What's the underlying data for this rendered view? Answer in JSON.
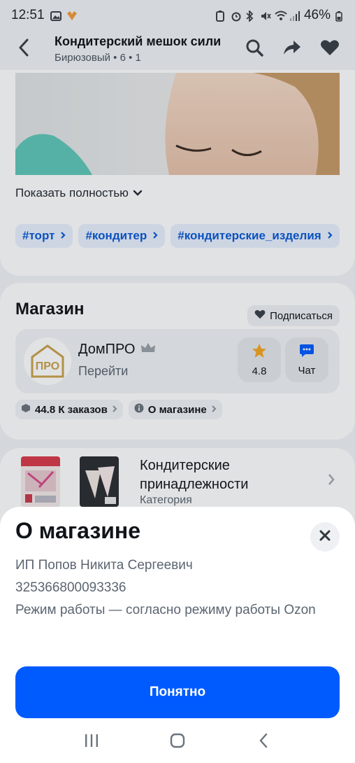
{
  "status_bar": {
    "time": "12:51",
    "battery": "46%"
  },
  "app_bar": {
    "title": "Кондитерский мешок сили",
    "subtitle": "Бирюзовый • 6 • 1"
  },
  "product": {
    "show_more": "Показать полностью",
    "tags": [
      "#торт",
      "#кондитер",
      "#кондитерские_изделия"
    ]
  },
  "shop": {
    "section_title": "Магазин",
    "subscribe": "Подписаться",
    "name": "ДомПРО",
    "go": "Перейти",
    "logo_text": "ПРО",
    "rating": "4.8",
    "chat": "Чат",
    "orders": "44.8 К заказов",
    "about": "О магазине"
  },
  "category": {
    "name": "Кондитерские принадлежности",
    "sub": "Категория"
  },
  "sheet": {
    "title": "О магазине",
    "lines": [
      "ИП Попов Никита Сергеевич",
      "325366800093336",
      "Режим работы — согласно режиму работы Ozon"
    ],
    "ok": "Понятно"
  },
  "colors": {
    "accent": "#005bff",
    "tag_bg": "#e8f1ff",
    "tag_text": "#0a5ad6",
    "star": "#f5a623",
    "chat_icon": "#005bff"
  }
}
